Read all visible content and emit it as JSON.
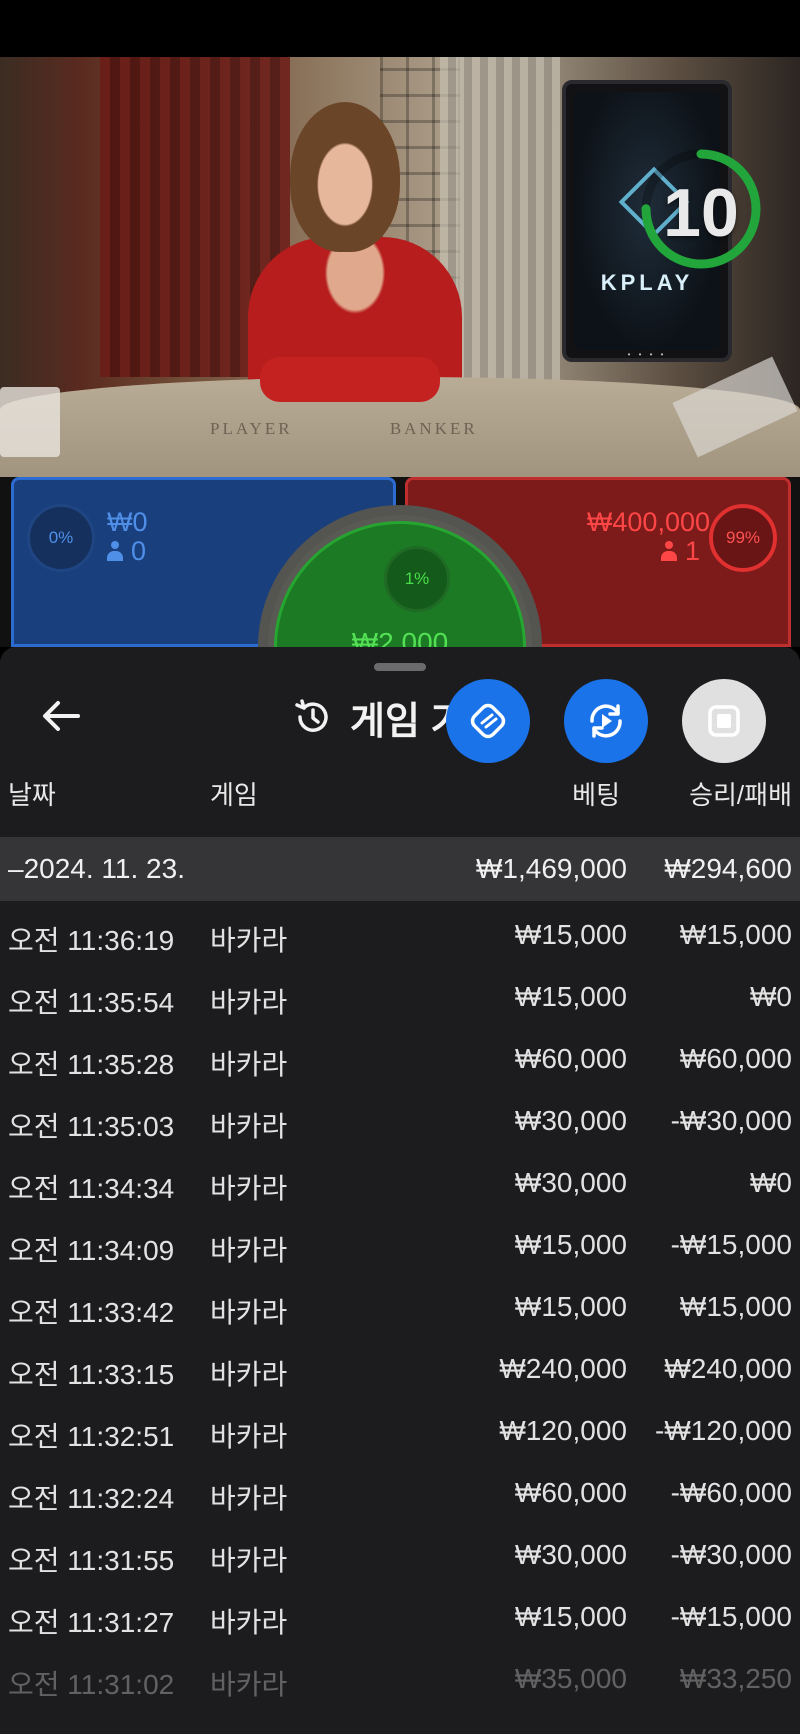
{
  "stream": {
    "countdown": "10",
    "countdown_fraction": 0.75,
    "monitor_brand": "KPLAY",
    "table_labels": [
      "PLAYER",
      "BANKER"
    ]
  },
  "bets": {
    "player": {
      "percent": "0%",
      "amount": "₩0",
      "players": "0"
    },
    "tie": {
      "percent": "1%",
      "amount": "₩2,000"
    },
    "banker": {
      "percent": "99%",
      "amount": "₩400,000",
      "players": "1"
    }
  },
  "history": {
    "title": "게임 기",
    "columns": {
      "date": "날짜",
      "game": "게임",
      "bet": "베팅",
      "win_loss": "승리/패배"
    },
    "day": {
      "date": "–2024. 11. 23.",
      "bet_total": "₩1,469,000",
      "win_loss_total": "₩294,600"
    },
    "rows": [
      {
        "time": "오전 11:36:19",
        "game": "바카라",
        "bet": "₩15,000",
        "result": "₩15,000"
      },
      {
        "time": "오전 11:35:54",
        "game": "바카라",
        "bet": "₩15,000",
        "result": "₩0"
      },
      {
        "time": "오전 11:35:28",
        "game": "바카라",
        "bet": "₩60,000",
        "result": "₩60,000"
      },
      {
        "time": "오전 11:35:03",
        "game": "바카라",
        "bet": "₩30,000",
        "result": "-₩30,000"
      },
      {
        "time": "오전 11:34:34",
        "game": "바카라",
        "bet": "₩30,000",
        "result": "₩0"
      },
      {
        "time": "오전 11:34:09",
        "game": "바카라",
        "bet": "₩15,000",
        "result": "-₩15,000"
      },
      {
        "time": "오전 11:33:42",
        "game": "바카라",
        "bet": "₩15,000",
        "result": "₩15,000"
      },
      {
        "time": "오전 11:33:15",
        "game": "바카라",
        "bet": "₩240,000",
        "result": "₩240,000"
      },
      {
        "time": "오전 11:32:51",
        "game": "바카라",
        "bet": "₩120,000",
        "result": "-₩120,000"
      },
      {
        "time": "오전 11:32:24",
        "game": "바카라",
        "bet": "₩60,000",
        "result": "-₩60,000"
      },
      {
        "time": "오전 11:31:55",
        "game": "바카라",
        "bet": "₩30,000",
        "result": "-₩30,000"
      },
      {
        "time": "오전 11:31:27",
        "game": "바카라",
        "bet": "₩15,000",
        "result": "-₩15,000"
      },
      {
        "time": "오전 11:31:02",
        "game": "바카라",
        "bet": "₩35,000",
        "result": "₩33,250"
      }
    ]
  },
  "icons": {
    "back": "arrow-left-icon",
    "history": "history-icon",
    "fab_1": "swap-icon",
    "fab_2": "replay-icon",
    "fab_3": "stop-icon"
  },
  "colors": {
    "player_blue": "#2c6bd0",
    "banker_red": "#c02f2f",
    "tie_green": "#26a530",
    "fab_blue": "#1a73e8"
  }
}
